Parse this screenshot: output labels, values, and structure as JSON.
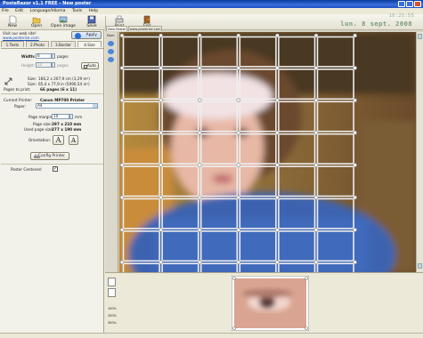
{
  "window": {
    "title": "PosteRazor v1.1 FREE - New poster"
  },
  "menu": [
    "File",
    "Edit",
    "Language/Idioma",
    "Tools",
    "Help"
  ],
  "toolbar": {
    "new": "New",
    "open": "Open",
    "open_image": "Open image",
    "save": "Save",
    "print": "Print",
    "exit": "Exit"
  },
  "clock": "10:25:55",
  "date": "lun. 8 sept. 2008",
  "left": {
    "visit": "Visit our web site!",
    "site": "www.posterize.com",
    "apply": "Apply",
    "tabs": [
      "1.Texts",
      "2.Photo",
      "3.Border",
      "4.Size"
    ],
    "width_label": "Width:",
    "width_value": "6",
    "height_label": "Height:",
    "height_value": "11",
    "unit": "pages",
    "auto": "Auto",
    "size_label_1": "Size:",
    "size_value_1": "166,2 x 207,9 cm (3,29 m²)",
    "size_label_2": "Size:",
    "size_value_2": "65,4 x 77,9 in (5090,54 in²)",
    "pages_label": "Pages to print:",
    "pages_value": "66 pages (6 x 11)",
    "printer_label": "Current Printer:",
    "printer_value": "Canon MP700 Printer",
    "paper_label": "Paper:",
    "paper_value": "A4",
    "margin_label": "Page margin:",
    "margin_value": "10",
    "margin_unit": "mm",
    "pagesize_label": "Page size:",
    "pagesize_value": "297 x 210 mm",
    "used_label": "Used page size:",
    "used_value": "277 x 190 mm",
    "orientation_label": "Orientation:",
    "config": "Config Printer",
    "centered_label": "Poster Centered:"
  },
  "right": {
    "tabs": [
      "View Poster",
      "www.posterize.com"
    ],
    "zoom_label": "Num",
    "preview_zoom": [
      "100%",
      "200%",
      "300%"
    ]
  }
}
